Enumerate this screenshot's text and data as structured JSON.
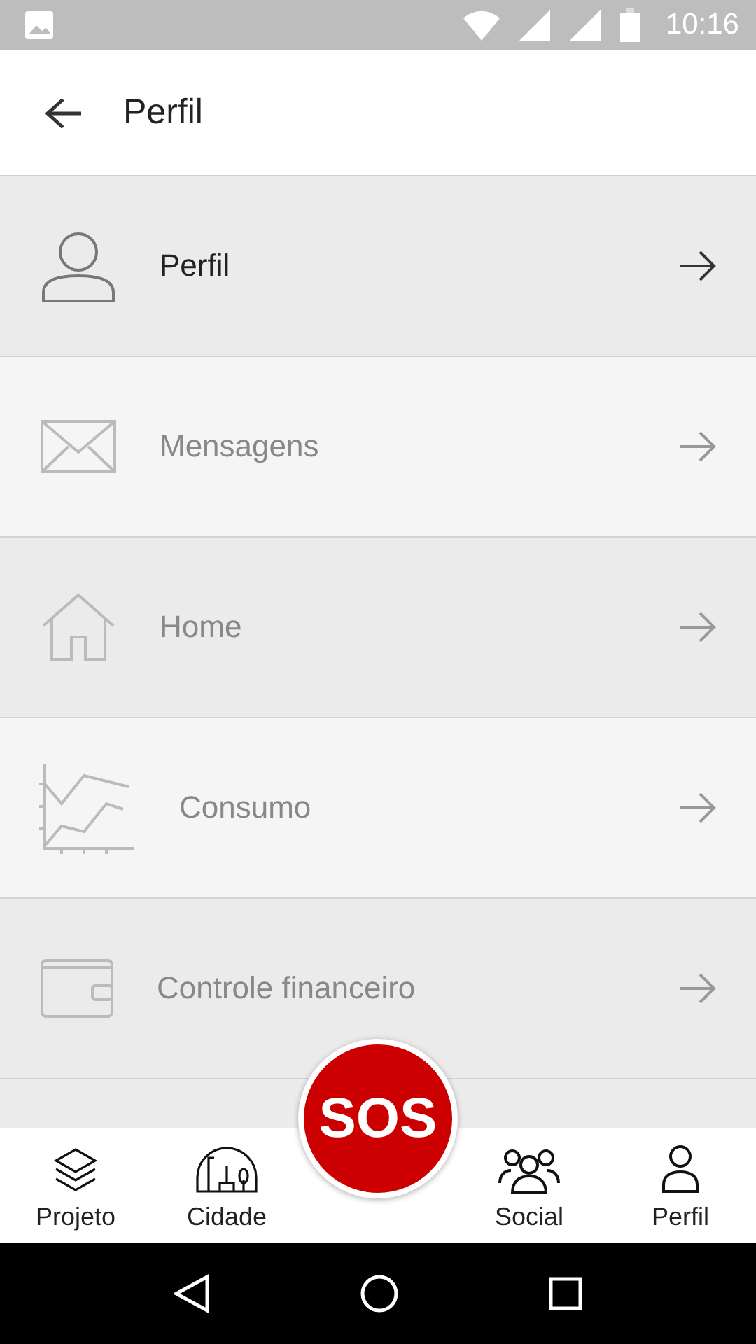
{
  "status_bar": {
    "time": "10:16"
  },
  "header": {
    "title": "Perfil"
  },
  "menu": [
    {
      "kind": "user",
      "label": "Perfil",
      "selected": true
    },
    {
      "kind": "mail",
      "label": "Mensagens",
      "selected": false
    },
    {
      "kind": "home",
      "label": "Home",
      "selected": false
    },
    {
      "kind": "chart",
      "label": "Consumo",
      "selected": false
    },
    {
      "kind": "wallet",
      "label": "Controle financeiro",
      "selected": false
    }
  ],
  "sos_button": {
    "label": "SOS"
  },
  "bottom_nav": [
    {
      "kind": "layers",
      "label": "Projeto"
    },
    {
      "kind": "city",
      "label": "Cidade"
    },
    {
      "kind": "gap"
    },
    {
      "kind": "group",
      "label": "Social"
    },
    {
      "kind": "user",
      "label": "Perfil"
    }
  ]
}
